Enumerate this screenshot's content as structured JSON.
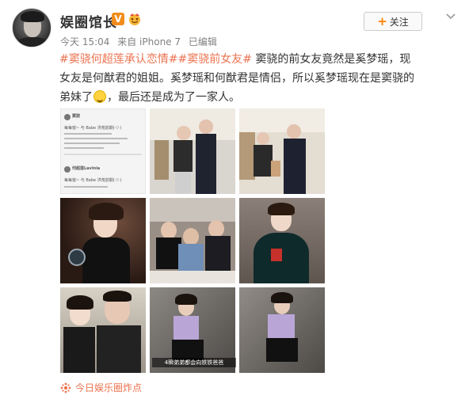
{
  "user": {
    "name": "娱圈馆长",
    "verified_badge": "V",
    "badge_color": "#f28c1c"
  },
  "meta": {
    "time": "今天 15:04",
    "source": "来自 iPhone 7",
    "edited": "已编辑"
  },
  "follow_button": {
    "plus": "+",
    "label": "关注"
  },
  "post": {
    "hashtag1": "#窦骁何超莲承认恋情#",
    "hashtag2": "#窦骁前女友#",
    "text_part1": " 窦骁的前女友竟然是奚梦瑶，现女友是何猷君的姐姐。奚梦瑶和何猷君是情侣，所以奚梦瑶现在是窦骁的弟妹了",
    "emoji": "laughing-tears-emoji",
    "text_part2": "，最后还是成为了一家人。",
    "hashtag_color": "#eb7350"
  },
  "images": {
    "cell1": {
      "user1": "窦骁",
      "line1": "每每窗~ 与 Babe 洪荒前期(·▽·)",
      "user2": "何超莲Lavinia",
      "line2": "每每窗~ 与 Babe 洪荒前期(·▽·)"
    },
    "cell8_caption": "4瞬弟弟都会向铁铁爸爸"
  },
  "footer": {
    "label": "今日娱乐圈炸点"
  }
}
